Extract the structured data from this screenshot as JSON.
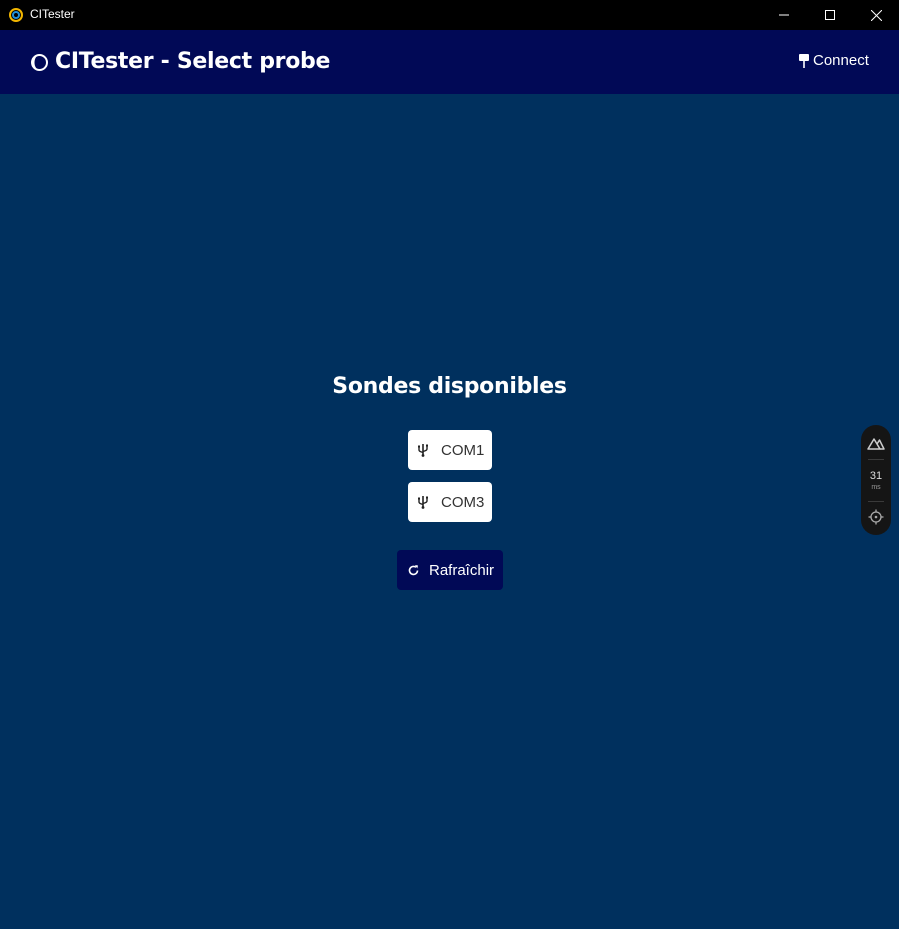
{
  "window": {
    "title": "CITester",
    "minimize_icon": "minimize-icon",
    "maximize_icon": "maximize-icon",
    "close_icon": "close-icon"
  },
  "header": {
    "title": "CITester - Select probe",
    "connect_label": "Connect",
    "logo_icon": "half-moon-icon",
    "connect_icon": "pushpin-icon",
    "background": "#010956"
  },
  "main": {
    "background": "#00305e",
    "section_title": "Sondes disponibles",
    "probes": [
      {
        "label": "COM1",
        "icon": "usb-icon"
      },
      {
        "label": "COM3",
        "icon": "usb-icon"
      }
    ],
    "refresh_label": "Rafraîchir",
    "refresh_icon": "refresh-icon"
  },
  "devtools": {
    "render_time": "31",
    "render_unit": "ms",
    "icons": [
      "nuxt-logo-icon",
      "crosshair-icon"
    ]
  }
}
